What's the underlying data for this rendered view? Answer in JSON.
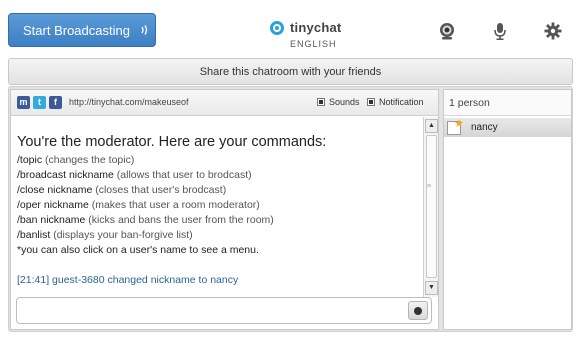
{
  "header": {
    "broadcast_label": "Start Broadcasting",
    "logo_text": "tinychat",
    "language": "ENGLISH",
    "icons": [
      "webcam-icon",
      "microphone-icon",
      "settings-gear-icon"
    ]
  },
  "share": {
    "label": "Share this chatroom with your friends"
  },
  "chat": {
    "social": [
      "myspace",
      "twitter",
      "facebook"
    ],
    "room_url": "http://tinychat.com/makeuseof",
    "options": {
      "sounds": "Sounds",
      "notification": "Notification"
    },
    "moderator_title": "You're the moderator. Here are your commands:",
    "commands": [
      {
        "cmd": "/topic",
        "desc": " (changes the topic)"
      },
      {
        "cmd": "/broadcast nickname",
        "desc": " (allows that user to brodcast)"
      },
      {
        "cmd": "/close nickname",
        "desc": " (closes that user's brodcast)"
      },
      {
        "cmd": "/oper nickname",
        "desc": " (makes that user a room moderator)"
      },
      {
        "cmd": "/ban nickname",
        "desc": " (kicks and bans the user from the room)"
      },
      {
        "cmd": "/banlist",
        "desc": " (displays your ban-forgive list)"
      }
    ],
    "tip": "*you can also click on a user's name to see a menu.",
    "system_message": "[21:41] guest-3680 changed nickname to nancy",
    "input_value": ""
  },
  "users": {
    "count_label": "1 person",
    "list": [
      {
        "name": "nancy",
        "moderator": true
      }
    ]
  },
  "colors": {
    "accent": "#3d7fc4",
    "logo": "#29a3d6",
    "system_text": "#2a6496"
  }
}
